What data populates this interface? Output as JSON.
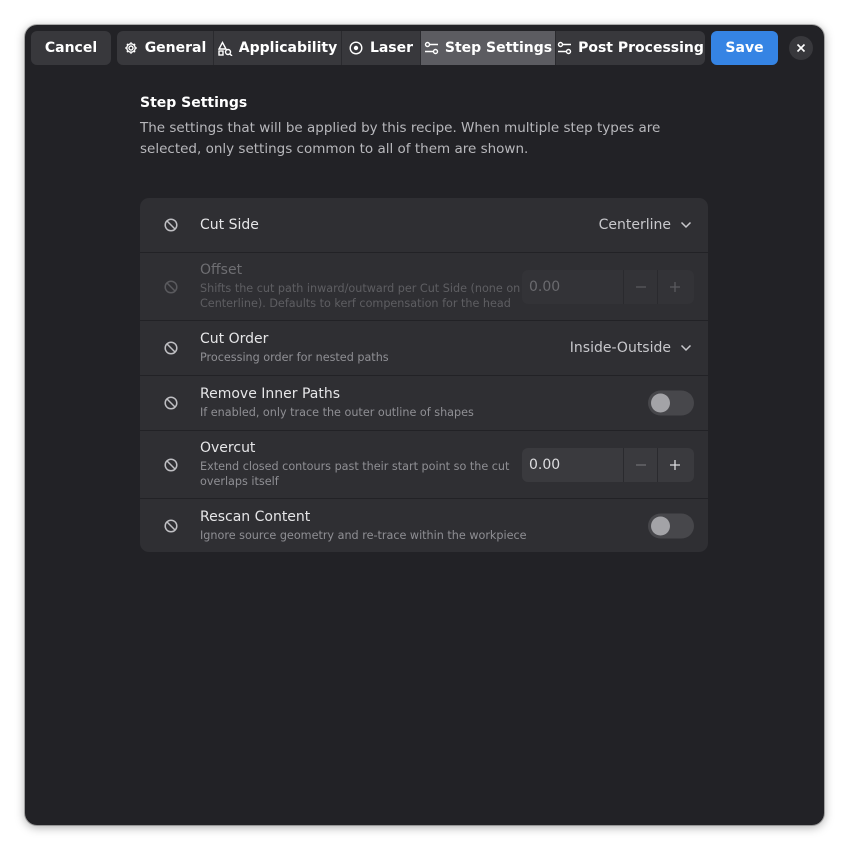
{
  "header": {
    "cancel_label": "Cancel",
    "save_label": "Save",
    "tabs": [
      {
        "label": "General",
        "icon": "gear-icon"
      },
      {
        "label": "Applicability",
        "icon": "shapes-search-icon"
      },
      {
        "label": "Laser",
        "icon": "target-icon"
      },
      {
        "label": "Step Settings",
        "icon": "sliders-icon",
        "active": true
      },
      {
        "label": "Post Processing",
        "icon": "sliders-icon"
      }
    ]
  },
  "page": {
    "title": "Step Settings",
    "description": "The settings that will be applied by this recipe. When multiple step types are selected, only settings common to all of them are shown."
  },
  "settings": [
    {
      "title": "Cut Side",
      "subtitle": "",
      "control": "dropdown",
      "value": "Centerline"
    },
    {
      "title": "Offset",
      "subtitle": "Shifts the cut path inward/outward per Cut Side (none on Centerline). Defaults to kerf compensation for the head",
      "control": "spin",
      "value": "0.00",
      "disabled": true
    },
    {
      "title": "Cut Order",
      "subtitle": "Processing order for nested paths",
      "control": "dropdown",
      "value": "Inside-Outside"
    },
    {
      "title": "Remove Inner Paths",
      "subtitle": "If enabled, only trace the outer outline of shapes",
      "control": "switch",
      "value": false
    },
    {
      "title": "Overcut",
      "subtitle": "Extend closed contours past their start point so the cut overlaps itself",
      "control": "spin",
      "value": "0.00"
    },
    {
      "title": "Rescan Content",
      "subtitle": "Ignore source geometry and re-trace within the workpiece",
      "control": "switch",
      "value": false
    }
  ],
  "colors": {
    "accent": "#3584e4",
    "window_bg": "#222226",
    "row_bg": "#2f2f33"
  }
}
